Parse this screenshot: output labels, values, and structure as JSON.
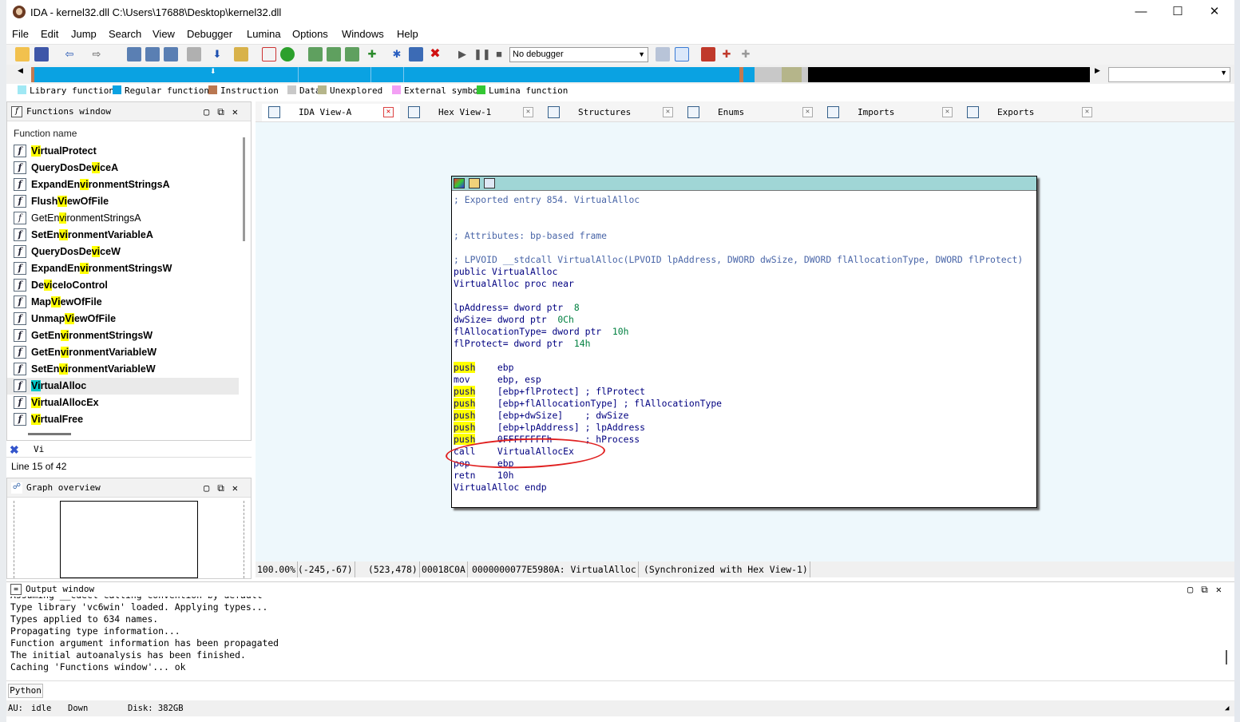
{
  "window": {
    "title": "IDA - kernel32.dll C:\\Users\\17688\\Desktop\\kernel32.dll",
    "minimize": "—",
    "maximize": "☐",
    "close": "✕"
  },
  "menu": [
    "File",
    "Edit",
    "Jump",
    "Search",
    "View",
    "Debugger",
    "Lumina",
    "Options",
    "Windows",
    "Help"
  ],
  "toolbar": {
    "debugger_select": "No debugger",
    "icons": [
      "open-file-icon",
      "save-icon",
      "back-arrow-icon",
      "forward-arrow-icon",
      "text-search-icon",
      "binary-search-icon",
      "immediate-search-icon",
      "string-search-icon",
      "jump-down-icon",
      "cross-ref-icon",
      "stop-analysis-icon",
      "run-icon",
      "pause-icon",
      "stop-icon"
    ]
  },
  "legend": [
    {
      "label": "Library function",
      "color": "#a0e8f4"
    },
    {
      "label": "Regular function",
      "color": "#0aa2e2"
    },
    {
      "label": "Instruction",
      "color": "#b97751"
    },
    {
      "label": "Data",
      "color": "#c8c8c8"
    },
    {
      "label": "Unexplored",
      "color": "#b5b58a"
    },
    {
      "label": "External symbol",
      "color": "#f3a0f4"
    },
    {
      "label": "Lumina function",
      "color": "#34c734"
    }
  ],
  "functions": {
    "title": "Functions window",
    "header": "Function name",
    "rows": [
      {
        "pre": "",
        "hl": "Vi",
        "post": "rtualProtect",
        "bold": true,
        "sel": false
      },
      {
        "pre": "QueryDosDe",
        "hl": "vi",
        "post": "ceA",
        "bold": true,
        "sel": false
      },
      {
        "pre": "ExpandEn",
        "hl": "vi",
        "post": "ronmentStringsA",
        "bold": true,
        "sel": false
      },
      {
        "pre": "Flush",
        "hl": "Vi",
        "post": "ewOfFile",
        "bold": true,
        "sel": false
      },
      {
        "pre": "GetEn",
        "hl": "vi",
        "post": "ronmentStringsA",
        "bold": false,
        "sel": false
      },
      {
        "pre": "SetEn",
        "hl": "vi",
        "post": "ronmentVariableA",
        "bold": true,
        "sel": false
      },
      {
        "pre": "QueryDosDe",
        "hl": "vi",
        "post": "ceW",
        "bold": true,
        "sel": false
      },
      {
        "pre": "ExpandEn",
        "hl": "vi",
        "post": "ronmentStringsW",
        "bold": true,
        "sel": false
      },
      {
        "pre": "De",
        "hl": "vi",
        "post": "ceIoControl",
        "bold": true,
        "sel": false
      },
      {
        "pre": "Map",
        "hl": "Vi",
        "post": "ewOfFile",
        "bold": true,
        "sel": false
      },
      {
        "pre": "Unmap",
        "hl": "Vi",
        "post": "ewOfFile",
        "bold": true,
        "sel": false
      },
      {
        "pre": "GetEn",
        "hl": "vi",
        "post": "ronmentStringsW",
        "bold": true,
        "sel": false
      },
      {
        "pre": "GetEn",
        "hl": "vi",
        "post": "ronmentVariableW",
        "bold": true,
        "sel": false
      },
      {
        "pre": "SetEn",
        "hl": "vi",
        "post": "ronmentVariableW",
        "bold": true,
        "sel": false
      },
      {
        "pre": "",
        "hl": "Vi",
        "post": "rtualAlloc",
        "bold": true,
        "sel": true
      },
      {
        "pre": "",
        "hl": "Vi",
        "post": "rtualAllocEx",
        "bold": true,
        "sel": false
      },
      {
        "pre": "",
        "hl": "Vi",
        "post": "rtualFree",
        "bold": true,
        "sel": false
      }
    ],
    "search": "Vi",
    "line_info": "Line 15 of 42"
  },
  "graph_overview": {
    "title": "Graph overview"
  },
  "tabs": [
    {
      "label": "IDA View-A",
      "active": true
    },
    {
      "label": "Hex View-1",
      "active": false
    },
    {
      "label": "Structures",
      "active": false
    },
    {
      "label": "Enums",
      "active": false
    },
    {
      "label": "Imports",
      "active": false
    },
    {
      "label": "Exports",
      "active": false
    }
  ],
  "code": {
    "comment_entry": "; Exported entry 854. VirtualAlloc",
    "comment_attr": "; Attributes: bp-based frame",
    "signature": "; LPVOID __stdcall VirtualAlloc(LPVOID lpAddress, DWORD dwSize, DWORD flAllocationType, DWORD flProtect)",
    "public_line": "public VirtualAlloc",
    "proc_line": "VirtualAlloc proc near",
    "vars": [
      {
        "name": "lpAddress= dword ptr  ",
        "off": "8"
      },
      {
        "name": "dwSize= dword ptr  ",
        "off": "0Ch"
      },
      {
        "name": "flAllocationType= dword ptr  ",
        "off": "10h"
      },
      {
        "name": "flProtect= dword ptr  ",
        "off": "14h"
      }
    ],
    "instrs": [
      {
        "op": "push",
        "hl": true,
        "args": "    ebp"
      },
      {
        "op": "mov",
        "hl": false,
        "args": "     ebp, esp"
      },
      {
        "op": "push",
        "hl": true,
        "args": "    [ebp+flProtect] ; flProtect"
      },
      {
        "op": "push",
        "hl": true,
        "args": "    [ebp+flAllocationType] ; flAllocationType"
      },
      {
        "op": "push",
        "hl": true,
        "args": "    [ebp+dwSize]    ; dwSize"
      },
      {
        "op": "push",
        "hl": true,
        "args": "    [ebp+lpAddress] ; lpAddress"
      },
      {
        "op": "push",
        "hl": true,
        "args": "    0FFFFFFFFh      ; hProcess"
      },
      {
        "op": "call",
        "hl": false,
        "args": "    VirtualAllocEx"
      },
      {
        "op": "pop",
        "hl": false,
        "args": "     ebp"
      },
      {
        "op": "retn",
        "hl": false,
        "args": "    10h"
      }
    ],
    "endp": "VirtualAlloc endp"
  },
  "status_line": [
    "100.00%",
    "(-245,-67)",
    "(523,478)",
    "00018C0A",
    "0000000077E5980A: VirtualAlloc",
    "(Synchronized with Hex View-1)"
  ],
  "output": {
    "title": "Output window",
    "lines": [
      "Assuming __cdecl calling convention by default",
      "Type library 'vc6win' loaded. Applying types...",
      "Types applied to 634 names.",
      "Propagating type information...",
      "Function argument information has been propagated",
      "The initial autoanalysis has been finished.",
      "Caching 'Functions window'... ok"
    ]
  },
  "python_btn": "Python",
  "statusbar": {
    "au": "AU:",
    "state": "idle",
    "dir": "Down",
    "disk": "Disk: 382GB"
  }
}
